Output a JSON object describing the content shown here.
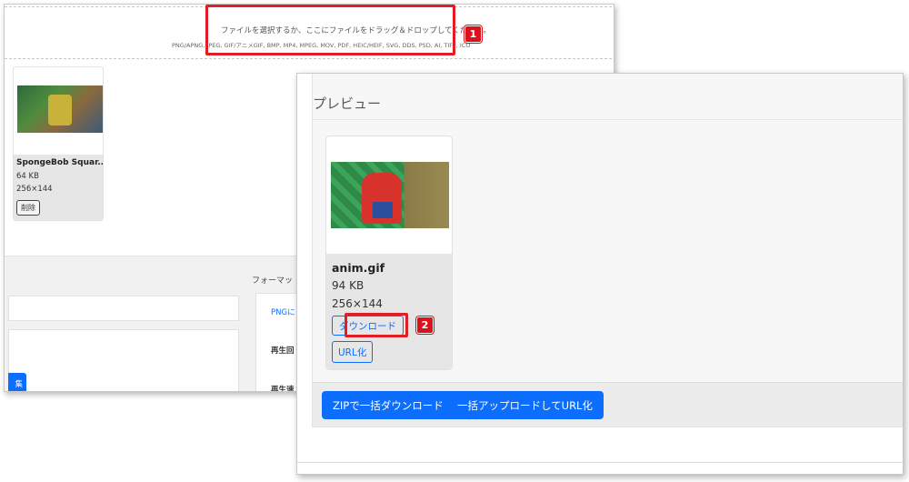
{
  "upload": {
    "main_text": "ファイルを選択するか、ここにファイルをドラッグ＆ドロップしてください。",
    "formats_text": "PNG/APNG, JPEG, GIF/アニメGIF, BMP, MP4, MPEG, MOV, PDF, HEIC/HEIF, SVG, DDS, PSD, AI, TIFF, ICO"
  },
  "callouts": {
    "one": "1",
    "two": "2"
  },
  "back_file": {
    "name": "SpongeBob Squar...",
    "size": "64 KB",
    "dimensions": "256×144",
    "delete_label": "削除"
  },
  "back_settings": {
    "format_label": "フォーマッ",
    "png_link": "PNGに",
    "playback_1": "再生回",
    "playback_2": "再生速",
    "edit_button": "集"
  },
  "preview": {
    "title": "プレビュー",
    "file": {
      "name": "anim.gif",
      "size": "94 KB",
      "dimensions": "256×144",
      "download_label": "ダウンロード",
      "url_label": "URL化"
    },
    "zip_button": "ZIPで一括ダウンロード",
    "bulk_upload_button": "一括アップロードしてURL化"
  },
  "colors": {
    "accent": "#0d6efd",
    "callout": "#e01e26"
  }
}
